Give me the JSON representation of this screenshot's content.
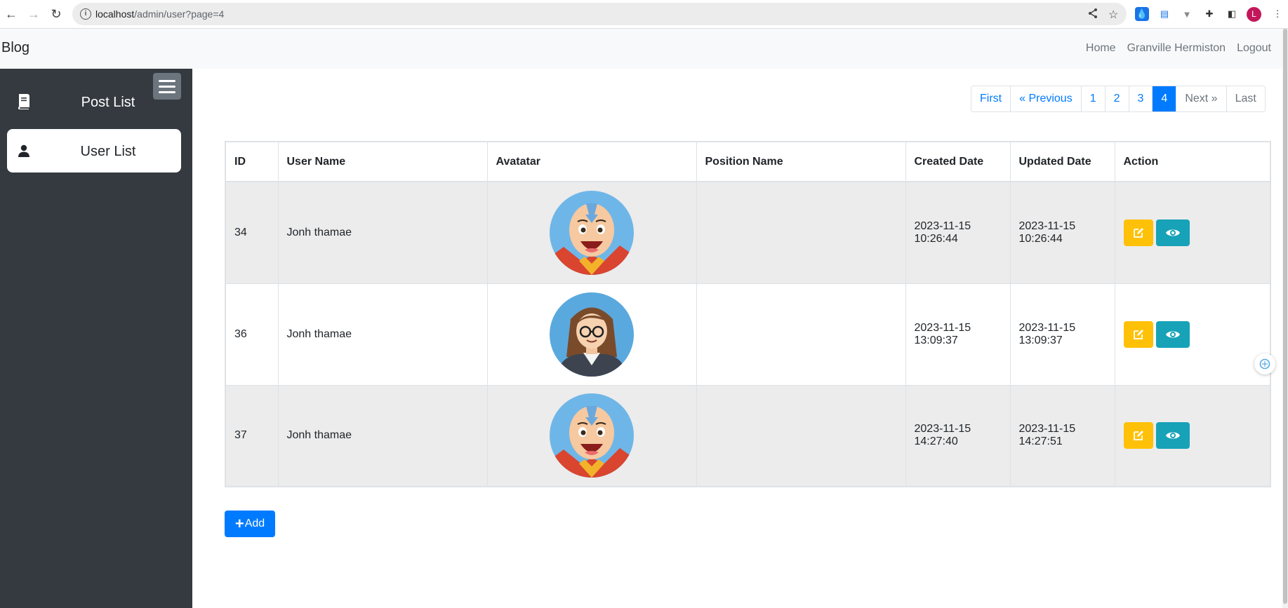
{
  "browser": {
    "url_host": "localhost",
    "url_path": "/admin/user?page=4",
    "profile_initial": "L"
  },
  "navbar": {
    "brand": "Blog",
    "links": [
      "Home",
      "Granville Hermiston",
      "Logout"
    ]
  },
  "sidebar": {
    "items": [
      {
        "label": "Post List",
        "icon": "book-icon",
        "active": false
      },
      {
        "label": "User List",
        "icon": "user-icon",
        "active": true
      }
    ]
  },
  "pagination": {
    "first": "First",
    "previous": "« Previous",
    "pages": [
      "1",
      "2",
      "3",
      "4"
    ],
    "current": "4",
    "next": "Next »",
    "last": "Last"
  },
  "table": {
    "headers": [
      "ID",
      "User Name",
      "Avatatar",
      "Position Name",
      "Created Date",
      "Updated Date",
      "Action"
    ],
    "rows": [
      {
        "id": "34",
        "user_name": "Jonh thamae",
        "avatar": "avatar-aang",
        "position": "",
        "created_date": "2023-11-15",
        "created_time": "10:26:44",
        "updated_date": "2023-11-15",
        "updated_time": "10:26:44"
      },
      {
        "id": "36",
        "user_name": "Jonh thamae",
        "avatar": "avatar-woman-glasses",
        "position": "",
        "created_date": "2023-11-15",
        "created_time": "13:09:37",
        "updated_date": "2023-11-15",
        "updated_time": "13:09:37"
      },
      {
        "id": "37",
        "user_name": "Jonh thamae",
        "avatar": "avatar-aang",
        "position": "",
        "created_date": "2023-11-15",
        "created_time": "14:27:40",
        "updated_date": "2023-11-15",
        "updated_time": "14:27:51"
      }
    ]
  },
  "add_button": {
    "label": "Add"
  },
  "colors": {
    "primary": "#007bff",
    "warning": "#ffc107",
    "info": "#17a2b8",
    "sidebar": "#343a40"
  }
}
